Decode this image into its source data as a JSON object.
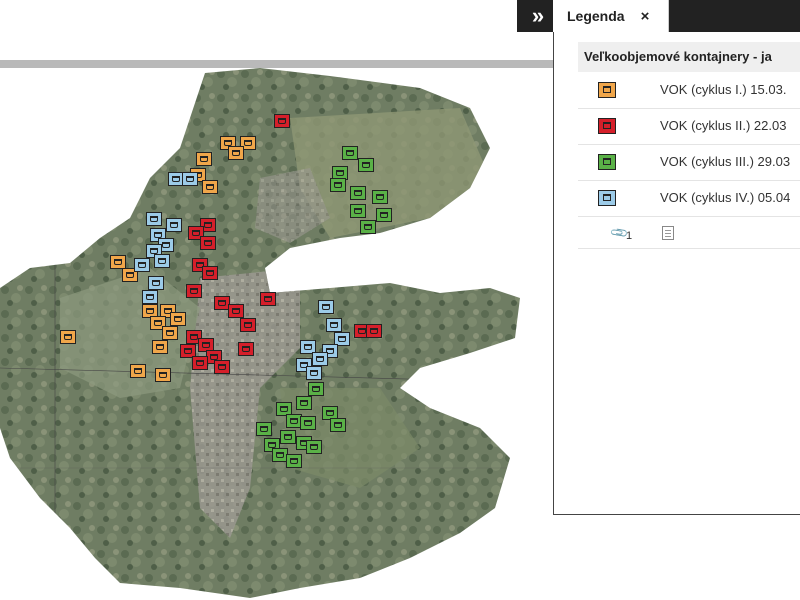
{
  "legend": {
    "tab_title": "Legenda",
    "close_symbol": "×",
    "toggle_icon": "double-chevron-right-icon",
    "layer_title": "Veľkoobjemové kontajnery - ja",
    "items": [
      {
        "label": "VOK (cyklus I.) 15.03.",
        "color": "#f0a64a",
        "icon": "container-icon"
      },
      {
        "label": "VOK (cyklus II.) 22.03",
        "color": "#d51f2a",
        "icon": "container-icon"
      },
      {
        "label": "VOK (cyklus III.) 29.03",
        "color": "#5ab147",
        "icon": "container-icon"
      },
      {
        "label": "VOK (cyklus IV.) 05.04",
        "color": "#9ccbe8",
        "icon": "container-icon"
      }
    ],
    "attachment_count": "1",
    "attachment_icon": "paperclip-icon",
    "document_icon": "document-icon"
  },
  "map": {
    "basemap": "aerial-orthophoto",
    "marker_icon": "container-icon"
  }
}
